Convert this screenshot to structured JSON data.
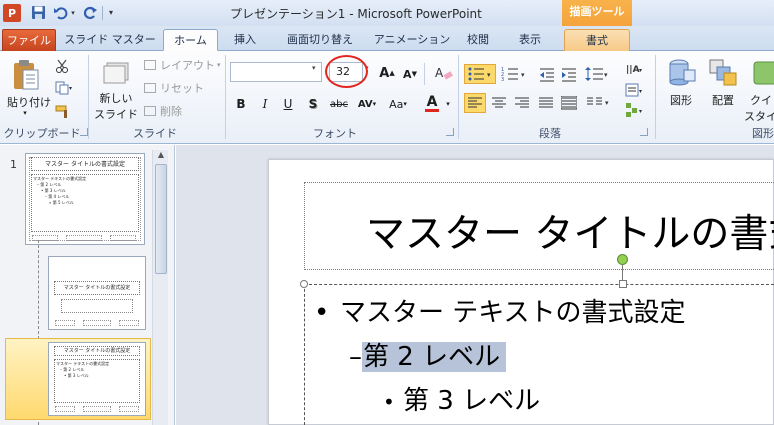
{
  "window": {
    "title": "プレゼンテーション1 - Microsoft PowerPoint",
    "contextual_group": "描画ツール",
    "app_icon_letter": "P"
  },
  "tabs": [
    {
      "label": "ファイル"
    },
    {
      "label": "スライド マスター"
    },
    {
      "label": "ホーム"
    },
    {
      "label": "挿入"
    },
    {
      "label": "画面切り替え"
    },
    {
      "label": "アニメーション"
    },
    {
      "label": "校閲"
    },
    {
      "label": "表示"
    },
    {
      "label": "書式"
    }
  ],
  "ribbon": {
    "clipboard": {
      "label": "クリップボード",
      "paste": "貼り付け"
    },
    "slides": {
      "label": "スライド",
      "new_slide": "新しい",
      "new_slide2": "スライド",
      "layout": "レイアウト",
      "reset": "リセット",
      "delete": "削除"
    },
    "font": {
      "label": "フォント",
      "font_name": "",
      "font_size": "32",
      "grow": "A",
      "shrink": "A",
      "bold": "B",
      "italic": "I",
      "underline": "U",
      "shadow": "S",
      "strike": "abc",
      "spacing": "AV",
      "case": "Aa",
      "color": "A"
    },
    "paragraph": {
      "label": "段落"
    },
    "drawing": {
      "shapes": "図形",
      "arrange": "配置",
      "quick_styles": "クイック",
      "quick_styles2": "スタイル",
      "label": "図形"
    }
  },
  "thumbnails": [
    {
      "number": "1",
      "title": "マスター タイトルの書式設定",
      "body": [
        "マスター テキストの書式設定",
        "– 第 2 レベル",
        "• 第 3 レベル",
        "– 第 4 レベル",
        "» 第 5 レベル"
      ]
    },
    {
      "number": "",
      "title": "マスター タイトルの書式設定"
    },
    {
      "number": "",
      "title": "マスター タイトルの書式設定",
      "body": [
        "マスター テキストの書式設定",
        "– 第 2 レベル",
        "• 第 3 レベル"
      ]
    }
  ],
  "slide": {
    "title": "マスター タイトルの書式設",
    "level1_bullet": "•",
    "level1": "マスター テキストの書式設定",
    "level2_dash": "–",
    "level2": "第 2 レベル",
    "level3_bullet": "•",
    "level3": "第 3 レベル"
  },
  "colors": {
    "accent": "#d24726",
    "format_tab": "#f7c987",
    "selection": "#b6c3d8",
    "circle": "#e0261f"
  }
}
